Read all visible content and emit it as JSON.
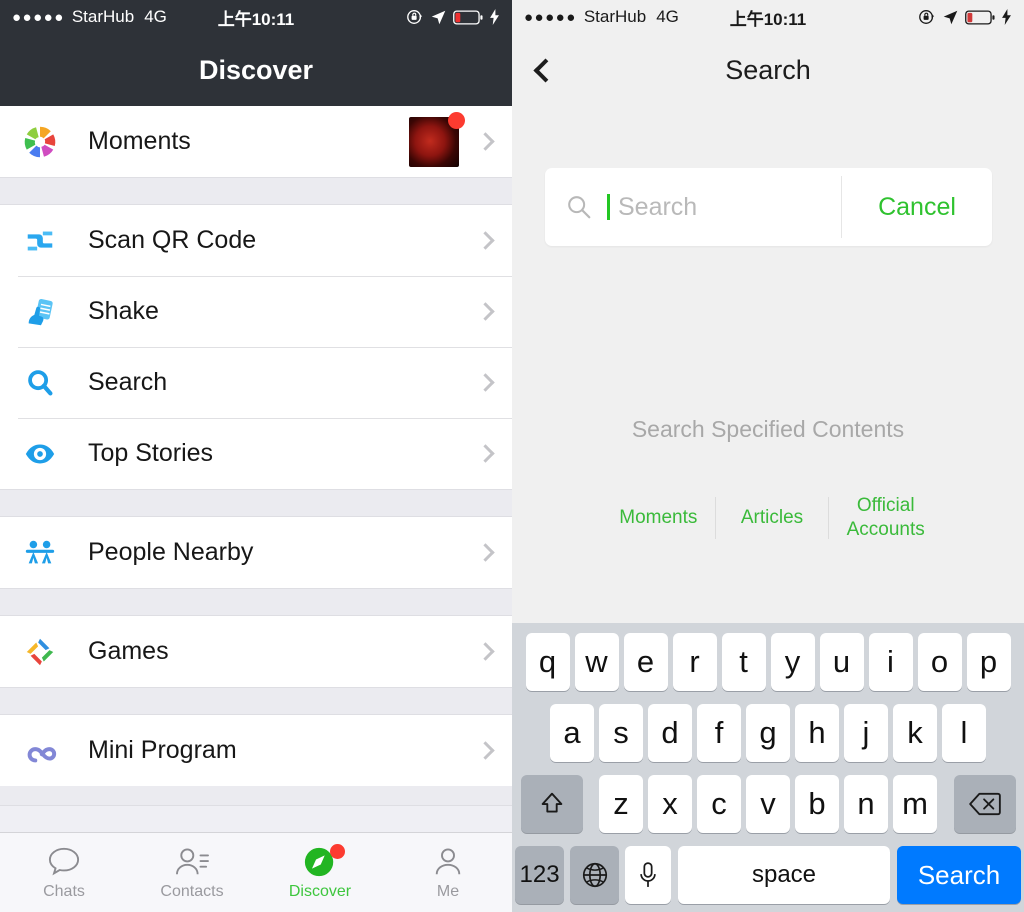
{
  "status_bar": {
    "signal_dots": "●●●●●",
    "carrier": "StarHub",
    "network": "4G",
    "time": "上午10:11",
    "icons": [
      "rotation-lock-icon",
      "location-arrow-icon",
      "battery-low-icon",
      "charging-bolt-icon"
    ]
  },
  "discover": {
    "title": "Discover",
    "groups": [
      {
        "items": [
          {
            "label": "Moments",
            "icon": "moments-aperture-icon",
            "thumbnail": "red-rose-photo",
            "badge": true
          }
        ]
      },
      {
        "items": [
          {
            "label": "Scan QR Code",
            "icon": "scan-qr-icon"
          },
          {
            "label": "Shake",
            "icon": "shake-icon"
          },
          {
            "label": "Search",
            "icon": "search-magnifier-icon"
          },
          {
            "label": "Top Stories",
            "icon": "eye-icon"
          }
        ]
      },
      {
        "items": [
          {
            "label": "People Nearby",
            "icon": "people-nearby-icon"
          }
        ]
      },
      {
        "items": [
          {
            "label": "Games",
            "icon": "games-diamond-icon"
          }
        ]
      },
      {
        "items": [
          {
            "label": "Mini Program",
            "icon": "mini-program-icon"
          }
        ]
      }
    ],
    "tabbar": {
      "active": "Discover",
      "tabs": [
        {
          "label": "Chats",
          "icon": "chat-bubble-icon",
          "badge": false
        },
        {
          "label": "Contacts",
          "icon": "contacts-icon",
          "badge": false
        },
        {
          "label": "Discover",
          "icon": "compass-icon",
          "badge": true
        },
        {
          "label": "Me",
          "icon": "person-icon",
          "badge": false
        }
      ]
    }
  },
  "search_screen": {
    "title": "Search",
    "back_icon": "back-chevron-icon",
    "search_box": {
      "icon": "search-magnifier-icon",
      "placeholder": "Search",
      "value": "",
      "cancel_label": "Cancel"
    },
    "hint": "Search Specified Contents",
    "filters": [
      "Moments",
      "Articles",
      "Official\nAccounts"
    ],
    "keyboard": {
      "row1": [
        "q",
        "w",
        "e",
        "r",
        "t",
        "y",
        "u",
        "i",
        "o",
        "p"
      ],
      "row2": [
        "a",
        "s",
        "d",
        "f",
        "g",
        "h",
        "j",
        "k",
        "l"
      ],
      "row3_letters": [
        "z",
        "x",
        "c",
        "v",
        "b",
        "n",
        "m"
      ],
      "shift_icon": "shift-arrow-icon",
      "backspace_icon": "backspace-icon",
      "numbers_label": "123",
      "globe_icon": "globe-icon",
      "mic_icon": "microphone-icon",
      "space_label": "space",
      "return_label": "Search"
    }
  },
  "colors": {
    "wechat_green": "#3ec63e",
    "ios_blue": "#007aff",
    "badge_red": "#fc3b30",
    "navbar_dark": "#2e3238"
  }
}
